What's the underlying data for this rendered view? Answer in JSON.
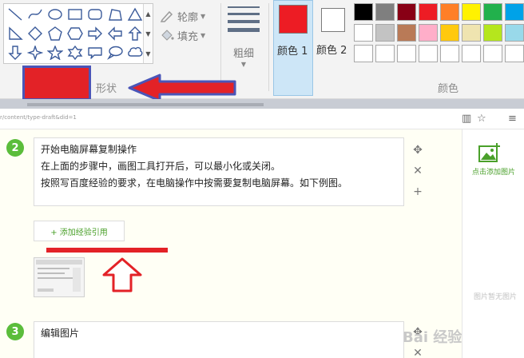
{
  "ribbon": {
    "shape_icons": [
      "line-shape",
      "curve-shape",
      "oval-shape",
      "rectangle-shape",
      "rounded-rectangle-shape",
      "polygon-shape",
      "triangle-shape",
      "right-triangle-shape",
      "diamond-shape",
      "pentagon-shape",
      "hexagon-shape",
      "right-arrow-shape",
      "left-arrow-shape",
      "up-arrow-shape",
      "down-arrow-shape",
      "four-point-star-shape",
      "five-point-star-shape",
      "six-point-star-shape",
      "rounded-callout-shape",
      "oval-callout-shape",
      "cloud-callout-shape"
    ],
    "outline_label": "轮廓",
    "fill_label": "填充",
    "size_label": "粗细",
    "shapes_group_label": "形状",
    "color1_label": "颜色 1",
    "color2_label": "颜色 2",
    "colors_group_label": "颜色",
    "color1_value": "#ed1c24",
    "color2_value": "#ffffff",
    "palette_row1": [
      "#000000",
      "#7f7f7f",
      "#880015",
      "#ed1c24",
      "#ff7f27",
      "#fff200",
      "#22b14c",
      "#00a2e8"
    ],
    "palette_row2": [
      "#ffffff",
      "#c3c3c3",
      "#b97a57",
      "#ffaec9",
      "#ffc90e",
      "#efe4b0",
      "#b5e61d",
      "#99d9ea"
    ]
  },
  "browser": {
    "url_text": "r/content/type-draft&did=1"
  },
  "editor": {
    "steps": [
      {
        "number": "2",
        "lines": [
          "开始电脑屏幕复制操作",
          "在上面的步骤中，画图工具打开后，可以最小化或关闭。",
          "按照写百度经验的要求，在电脑操作中按需要复制电脑屏幕。如下例图。"
        ]
      },
      {
        "number": "3",
        "lines": [
          "编辑图片"
        ]
      }
    ],
    "cite_button": "+ 添加经验引用"
  },
  "right_panel": {
    "add_image_label": "点击添加图片",
    "no_image_text": "图片暂无图片"
  },
  "watermark": "Bai 经验",
  "accent_red": "#e32227",
  "accent_blue": "#4a55b8",
  "accent_green": "#5bbd3b"
}
